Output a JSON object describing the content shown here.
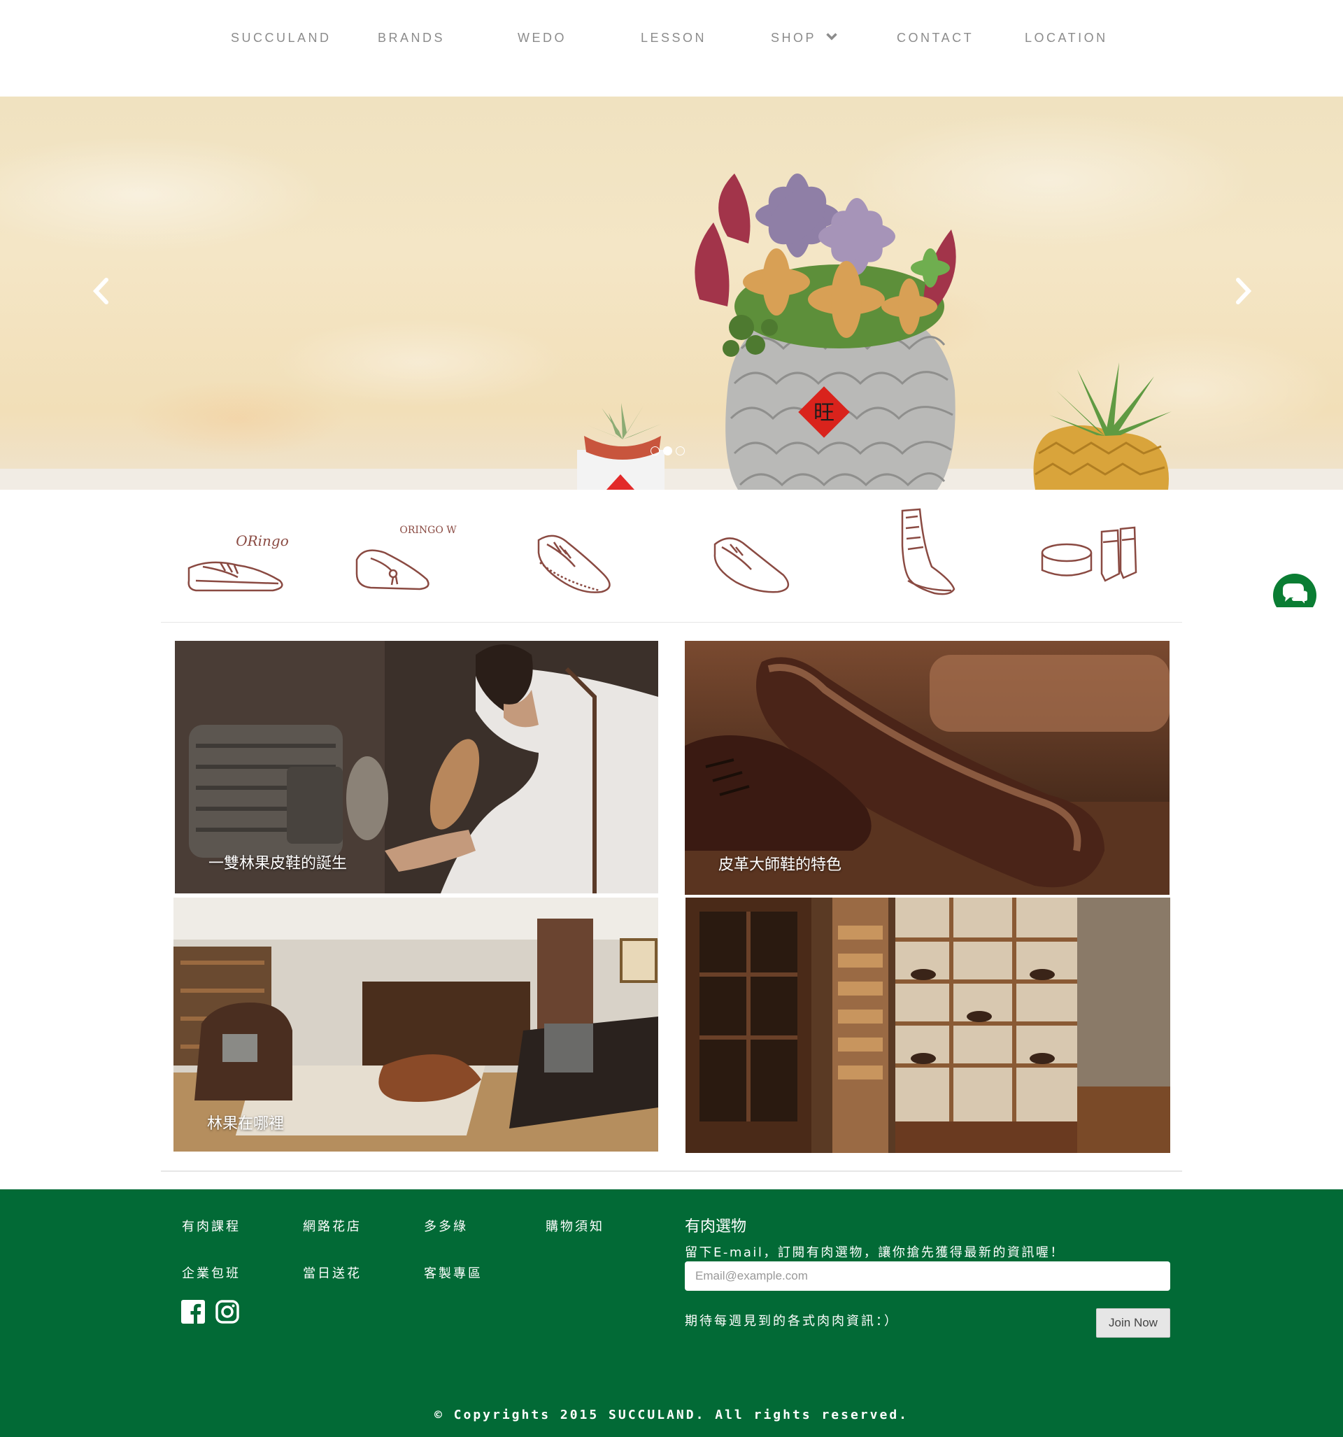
{
  "nav": {
    "items": [
      "SUCCULAND",
      "BRANDS",
      "WEDO",
      "LESSON",
      "SHOP",
      "CONTACT",
      "LOCATION"
    ]
  },
  "hero": {
    "slide_count": 3,
    "active_slide": 2,
    "sign_char": "旺"
  },
  "brands": {
    "logos": [
      "ORingo",
      "ORINGO W",
      "brogue-shoe",
      "derby-shoe",
      "boot",
      "shoe-care-kit"
    ],
    "logo_texts": [
      "ORingo",
      "ORINGO W"
    ]
  },
  "tiles": [
    {
      "caption": "一雙林果皮鞋的誕生"
    },
    {
      "caption": "皮革大師鞋的特色"
    },
    {
      "caption": "林果在哪裡"
    },
    {
      "caption": ""
    }
  ],
  "footer": {
    "links": [
      "有肉課程",
      "網路花店",
      "多多綠",
      "購物須知",
      "企業包班",
      "當日送花",
      "客製專區"
    ],
    "subscribe_title": "有肉選物",
    "subscribe_desc": "留下E-mail，訂閱有肉選物，讓你搶先獲得最新的資訊喔！",
    "email_placeholder": "Email@example.com",
    "note": "期待每週見到的各式肉肉資訊：）",
    "join_label": "Join Now",
    "copyright": "© Copyrights 2015 SUCCULAND. All rights reserved.",
    "social": [
      "facebook-icon",
      "instagram-icon"
    ]
  },
  "colors": {
    "footer_bg": "#026a36",
    "nav_text": "#8c8c8c",
    "sketch": "#8a4a42",
    "chat": "#0a7d33"
  }
}
